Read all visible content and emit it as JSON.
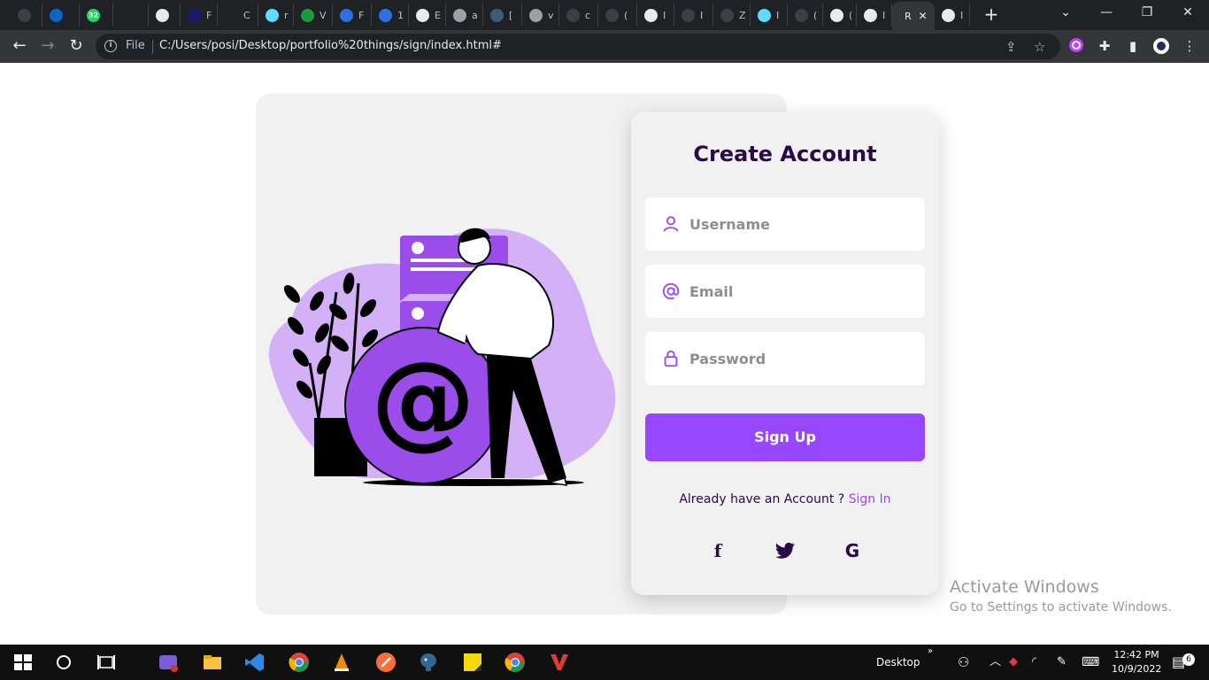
{
  "browser": {
    "tabs": [
      {
        "icon": "github-icon",
        "title": "",
        "color": "#3c3f44"
      },
      {
        "icon": "linkedin-icon",
        "title": "",
        "color": "#0a66c2"
      },
      {
        "icon": "whatsapp-icon",
        "title": "",
        "color": "#25d366",
        "badge": "32"
      },
      {
        "icon": "a-logo-icon",
        "title": "",
        "color": "#202124"
      },
      {
        "icon": "globe-icon",
        "title": "",
        "color": "#e8eaed"
      },
      {
        "icon": "a-logo-icon",
        "title": "F",
        "color": "#1a1a6e"
      },
      {
        "icon": "a-logo-icon",
        "title": "C",
        "color": "#202124"
      },
      {
        "icon": "react-icon",
        "title": "r",
        "color": "#61dafb"
      },
      {
        "icon": "w-logo-icon",
        "title": "V",
        "color": "#1d9a3b"
      },
      {
        "icon": "bookmark-icon",
        "title": "F",
        "color": "#2f6fde"
      },
      {
        "icon": "info-icon",
        "title": "1",
        "color": "#2f6fde"
      },
      {
        "icon": "v-logo-icon",
        "title": "E",
        "color": "#e8eaed"
      },
      {
        "icon": "diamond-icon",
        "title": "a",
        "color": "#9aa0a6"
      },
      {
        "icon": "diamond-icon",
        "title": "[",
        "color": "#3b5d7a"
      },
      {
        "icon": "slides-icon",
        "title": "v",
        "color": "#9aa0a6"
      },
      {
        "icon": "github-icon",
        "title": "c",
        "color": "#3c3f44"
      },
      {
        "icon": "github-icon",
        "title": "(",
        "color": "#3c3f44"
      },
      {
        "icon": "globe-icon",
        "title": "I",
        "color": "#e8eaed"
      },
      {
        "icon": "github-icon",
        "title": "I",
        "color": "#3c3f44"
      },
      {
        "icon": "github-icon",
        "title": "Z",
        "color": "#3c3f44"
      },
      {
        "icon": "react-icon",
        "title": "I",
        "color": "#61dafb"
      },
      {
        "icon": "github-icon",
        "title": "(",
        "color": "#3c3f44"
      },
      {
        "icon": "globe-icon",
        "title": "(",
        "color": "#e8eaed"
      },
      {
        "icon": "globe-icon",
        "title": "I",
        "color": "#e8eaed"
      },
      {
        "icon": "",
        "title": "R",
        "color": "",
        "active": true
      },
      {
        "icon": "globe-icon",
        "title": "I",
        "color": "#e8eaed"
      }
    ],
    "new_tab": "+",
    "address": {
      "scheme": "File",
      "url": "C:/Users/posi/Desktop/portfolio%20things/sign/index.html#"
    }
  },
  "page": {
    "form": {
      "title": "Create Account",
      "username_placeholder": "Username",
      "email_placeholder": "Email",
      "password_placeholder": "Password",
      "submit_label": "Sign Up",
      "already_text": "Already have an Account ?",
      "signin_link": "Sign In",
      "social": [
        {
          "name": "facebook-icon",
          "glyph": "f"
        },
        {
          "name": "twitter-icon",
          "glyph": "🐦"
        },
        {
          "name": "google-icon",
          "glyph": "G"
        }
      ]
    },
    "watermark": {
      "line1": "Activate Windows",
      "line2": "Go to Settings to activate Windows."
    }
  },
  "taskbar": {
    "desktop_label": "Desktop",
    "time": "12:42 PM",
    "date": "10/9/2022",
    "notifications": "6"
  },
  "colors": {
    "accent": "#9747ff",
    "heading": "#2a0a4a",
    "card_bg": "#f1f1f1"
  }
}
